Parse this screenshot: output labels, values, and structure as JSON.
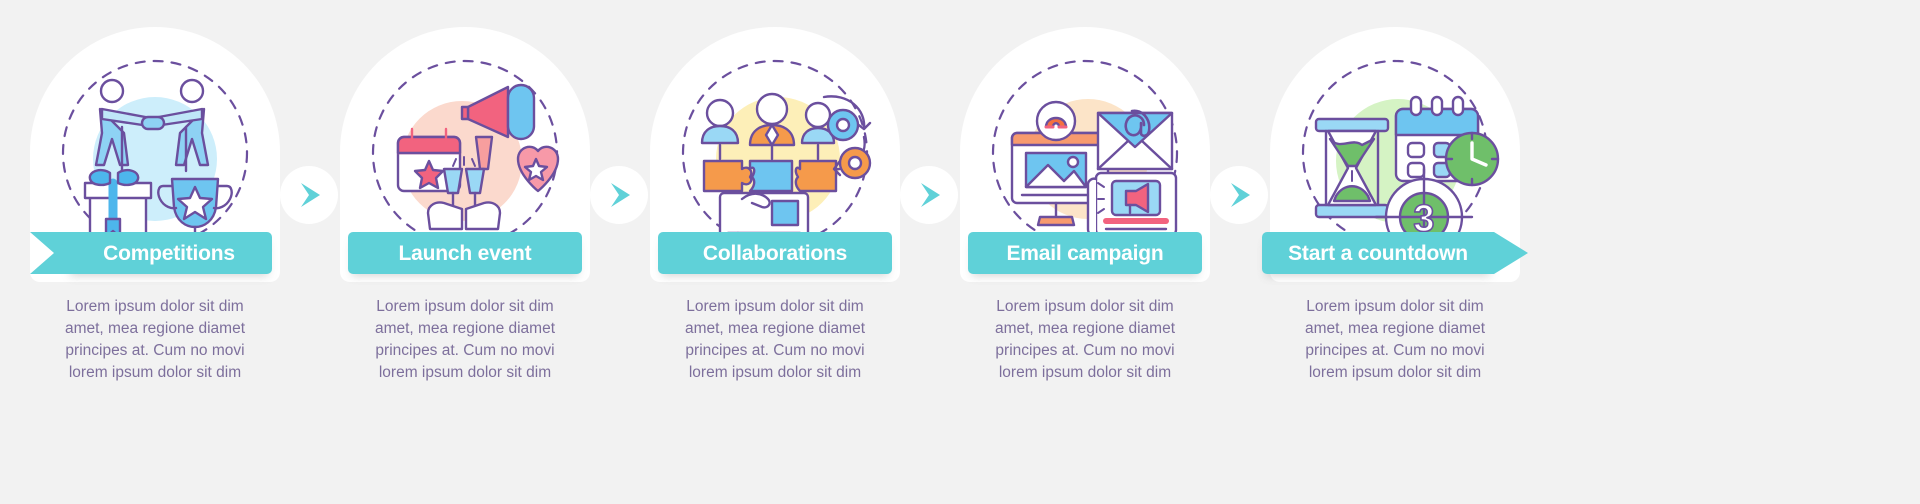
{
  "theme": {
    "background": "#f2f2f2",
    "card_background": "#ffffff",
    "banner_color": "#5fd1d8",
    "banner_text_color": "#ffffff",
    "body_text_color": "#7d6f9c",
    "connector_arrow_color": "#5fd1d8"
  },
  "steps": [
    {
      "label": "Competitions",
      "icon": "competition-trophy-gift-icon",
      "body": [
        "Lorem ipsum dolor sit dim",
        "amet, mea regione diamet",
        "principes at. Cum no movi",
        "lorem ipsum dolor sit dim"
      ]
    },
    {
      "label": "Launch event",
      "icon": "megaphone-calendar-toast-icon",
      "body": [
        "Lorem ipsum dolor sit dim",
        "amet, mea regione diamet",
        "principes at. Cum no movi",
        "lorem ipsum dolor sit dim"
      ]
    },
    {
      "label": "Collaborations",
      "icon": "team-puzzle-gears-contract-icon",
      "body": [
        "Lorem ipsum dolor sit dim",
        "amet, mea regione diamet",
        "principes at. Cum no movi",
        "lorem ipsum dolor sit dim"
      ]
    },
    {
      "label": "Email campaign",
      "icon": "monitor-envelope-at-megaphone-icon",
      "body": [
        "Lorem ipsum dolor sit dim",
        "amet, mea regione diamet",
        "principes at. Cum no movi",
        "lorem ipsum dolor sit dim"
      ]
    },
    {
      "label": "Start a countdown",
      "icon": "hourglass-calendar-clock-target-icon",
      "body": [
        "Lorem ipsum dolor sit dim",
        "amet, mea regione diamet",
        "principes at. Cum no movi",
        "lorem ipsum dolor sit dim"
      ]
    }
  ],
  "connectors": {
    "icon": "chevron-right-arrow-icon",
    "count": 4
  }
}
